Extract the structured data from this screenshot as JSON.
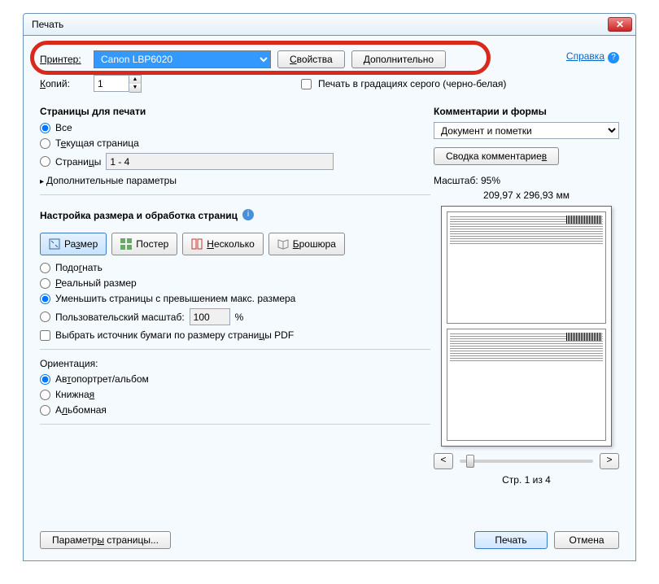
{
  "window": {
    "title": "Печать"
  },
  "help": {
    "label": "Справка"
  },
  "printer": {
    "label": "Принтер:",
    "selected": "Canon LBP6020",
    "properties_btn": "Свойства",
    "advanced_btn": "Дополнительно"
  },
  "copies": {
    "label": "Копий:",
    "value": "1"
  },
  "grayscale": {
    "label": "Печать в градациях серого (черно-белая)"
  },
  "pages": {
    "title": "Страницы для печати",
    "all": "Все",
    "current": "Текущая страница",
    "range_label": "Страницы",
    "range_value": "1 - 4",
    "more": "Дополнительные параметры"
  },
  "sizing": {
    "title": "Настройка размера и обработка страниц",
    "size_btn": "Размер",
    "poster_btn": "Постер",
    "multiple_btn": "Несколько",
    "booklet_btn": "Брошюра",
    "fit": "Подогнать",
    "actual": "Реальный размер",
    "shrink": "Уменьшить страницы с превышением макс. размера",
    "custom": "Пользовательский масштаб:",
    "custom_value": "100",
    "percent": "%",
    "paper_source": "Выбрать источник бумаги по размеру страницы PDF"
  },
  "orientation": {
    "title": "Ориентация:",
    "auto": "Автопортрет/альбом",
    "portrait": "Книжная",
    "landscape": "Альбомная"
  },
  "comments": {
    "title": "Комментарии и формы",
    "selected": "Документ и пометки",
    "summary_btn": "Сводка комментариев"
  },
  "preview": {
    "scale_label": "Масштаб: 95%",
    "dimensions": "209,97 x 296,93 мм",
    "page_info": "Стр. 1 из 4",
    "prev": "<",
    "next": ">"
  },
  "footer": {
    "page_setup": "Параметры страницы...",
    "print": "Печать",
    "cancel": "Отмена"
  }
}
